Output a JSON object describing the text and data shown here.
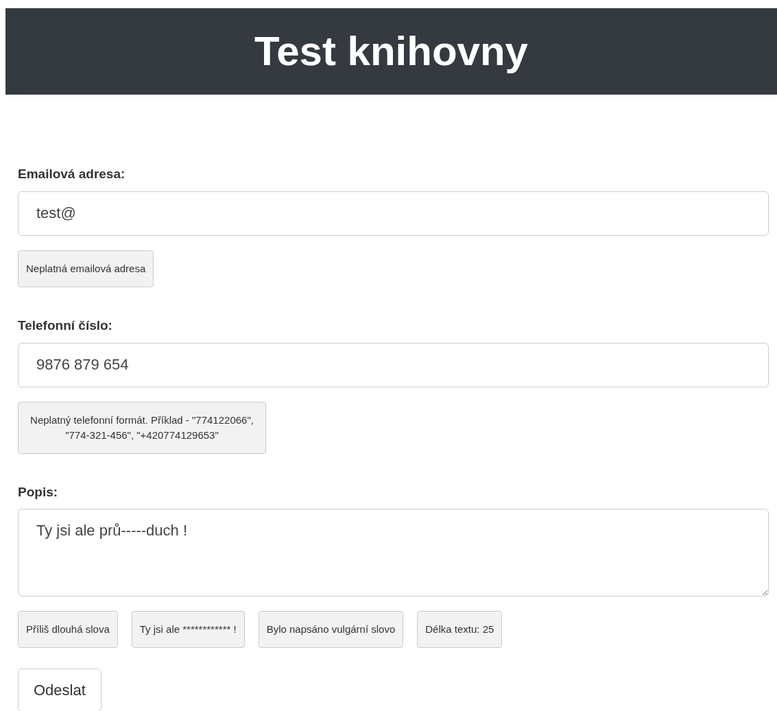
{
  "header": {
    "title": "Test knihovny"
  },
  "fields": [
    {
      "kind": "input",
      "label": "Emailová adresa:",
      "value": "test@",
      "messages": [
        "Neplatná emailová adresa"
      ]
    },
    {
      "kind": "input",
      "label": "Telefonní číslo:",
      "value": "9876 879 654",
      "messages": [
        "Neplatný telefonní formát. Příklad - \"774122066\", \"774-321-456\", \"+420774129653\""
      ]
    },
    {
      "kind": "textarea",
      "label": "Popis:",
      "value": "Ty jsi ale prů-----duch !",
      "messages": [
        "Příliš dlouhá slova",
        "Ty jsi ale ************ !",
        "Bylo napsáno vulgární slovo",
        "Délka textu: 25"
      ]
    }
  ],
  "submit": {
    "label": "Odeslat"
  }
}
